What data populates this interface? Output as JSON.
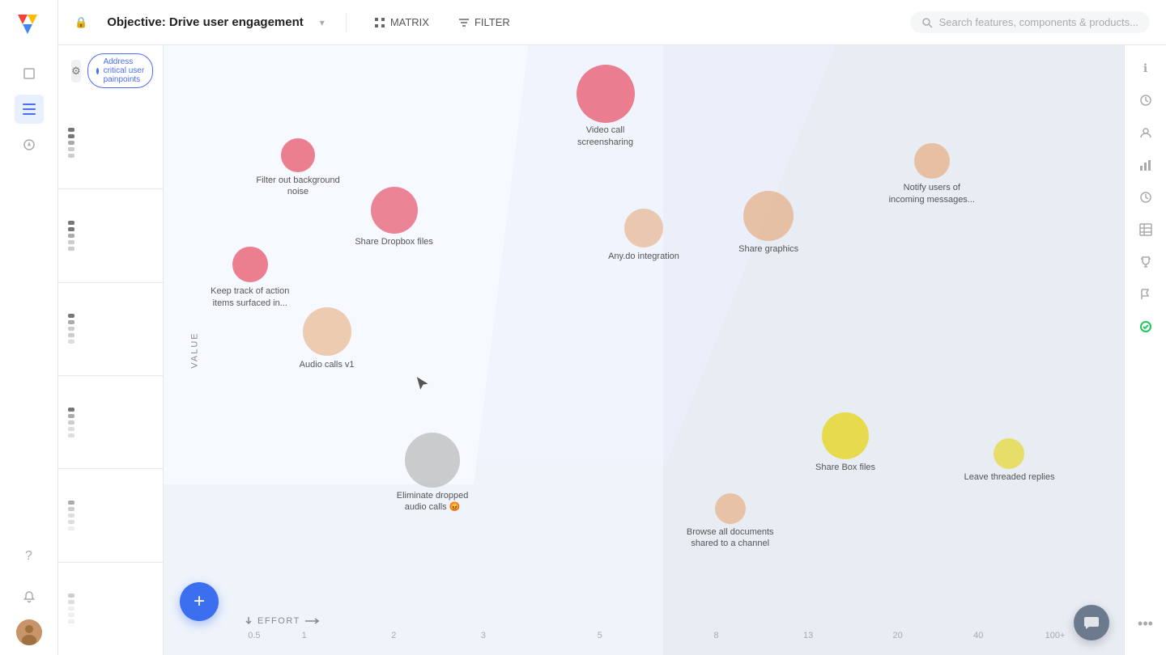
{
  "app": {
    "title": "Objective: Drive user engagement",
    "logo_colors": [
      "#f44336",
      "#fbbc04",
      "#4285f4",
      "#34a853"
    ]
  },
  "topbar": {
    "lock_label": "🔒",
    "title": "Objective: Drive user engagement",
    "dropdown_icon": "▾",
    "matrix_label": "MATRIX",
    "filter_label": "FILTER",
    "search_placeholder": "Search features, components & products..."
  },
  "left_panel": {
    "gear_icon": "⚙",
    "initiative_label": "Address critical user painpoints",
    "axis_rows": [
      {
        "dots": 5
      },
      {
        "dots": 5
      },
      {
        "dots": 5
      },
      {
        "dots": 5
      },
      {
        "dots": 5
      },
      {
        "dots": 5
      }
    ]
  },
  "x_axis": {
    "effort_label": "EFFORT",
    "ticks": [
      "0.5",
      "1",
      "2",
      "3",
      "5",
      "8",
      "13",
      "20",
      "40",
      "100+"
    ]
  },
  "y_axis": {
    "label": "VALUE"
  },
  "bubbles": [
    {
      "id": "video-call",
      "label": "Video call\nscreensharing",
      "x": 46,
      "y": 8,
      "size": 72,
      "color": "#e87d8a",
      "opacity": 0.85
    },
    {
      "id": "filter-background",
      "label": "Filter out background\nnoise",
      "x": 14,
      "y": 17,
      "size": 42,
      "color": "#e87d8a",
      "opacity": 0.85
    },
    {
      "id": "share-dropbox",
      "label": "Share Dropbox files",
      "x": 24,
      "y": 26,
      "size": 58,
      "color": "#e87d8a",
      "opacity": 0.8
    },
    {
      "id": "keep-track",
      "label": "Keep track of action\nitems surfaced in...",
      "x": 9,
      "y": 35,
      "size": 44,
      "color": "#e87d8a",
      "opacity": 0.85
    },
    {
      "id": "notify-users",
      "label": "Notify users of\nincoming messages...",
      "x": 79,
      "y": 18,
      "size": 44,
      "color": "#e8a87a",
      "opacity": 0.7
    },
    {
      "id": "share-graphics",
      "label": "Share graphics",
      "x": 62,
      "y": 28,
      "size": 62,
      "color": "#e8a87a",
      "opacity": 0.65
    },
    {
      "id": "anydo-integration",
      "label": "Any.do integration",
      "x": 50,
      "y": 30,
      "size": 48,
      "color": "#e8a87a",
      "opacity": 0.6
    },
    {
      "id": "audio-calls",
      "label": "Audio calls v1",
      "x": 17,
      "y": 46,
      "size": 60,
      "color": "#e8a87a",
      "opacity": 0.6
    },
    {
      "id": "eliminate-dropped",
      "label": "Eliminate dropped\naudio calls 😡",
      "x": 28,
      "y": 70,
      "size": 68,
      "color": "#bbb",
      "opacity": 0.7
    },
    {
      "id": "browse-documents",
      "label": "Browse all documents\nshared to a channel",
      "x": 59,
      "y": 77,
      "size": 38,
      "color": "#e8a87a",
      "opacity": 0.65
    },
    {
      "id": "share-box",
      "label": "Share Box files",
      "x": 71,
      "y": 66,
      "size": 58,
      "color": "#e8d84a",
      "opacity": 0.85
    },
    {
      "id": "leave-threaded",
      "label": "Leave threaded replies",
      "x": 88,
      "y": 68,
      "size": 38,
      "color": "#e8d84a",
      "opacity": 0.7
    }
  ],
  "sidebar_icons": [
    "📋",
    "☰",
    "🧭",
    "🕐",
    "📊",
    "🏆",
    "📌",
    "✅"
  ],
  "right_sidebar": {
    "icons": [
      "ℹ",
      "↺",
      "👤",
      "📊",
      "🕐",
      "📋",
      "🏆",
      "📌",
      "✅"
    ],
    "dots_label": "•••"
  },
  "fab": {
    "label": "+"
  },
  "chat": {
    "icon": "💬"
  }
}
